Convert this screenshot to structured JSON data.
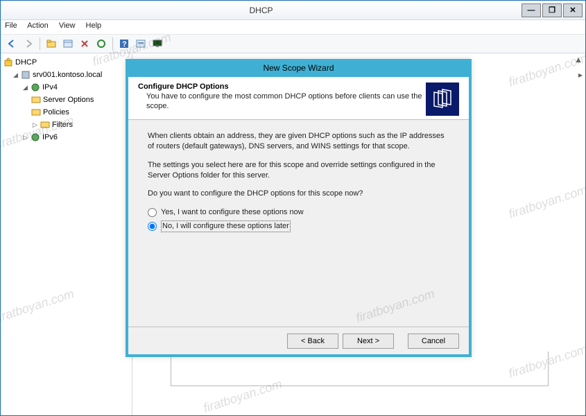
{
  "main": {
    "title": "DHCP",
    "menu": [
      "File",
      "Action",
      "View",
      "Help"
    ]
  },
  "window_controls": {
    "min": "—",
    "max": "❐",
    "close": "✕"
  },
  "tree": {
    "root": "DHCP",
    "server": "srv001.kontoso.local",
    "ipv4": "IPv4",
    "server_options": "Server Options",
    "policies": "Policies",
    "filters": "Filters",
    "ipv6": "IPv6"
  },
  "wizard": {
    "title": "New Scope Wizard",
    "heading": "Configure DHCP Options",
    "subtitle": "You have to configure the most common DHCP options before clients can use the scope.",
    "para1": "When clients obtain an address, they are given DHCP options such as the IP addresses of routers (default gateways), DNS servers, and WINS settings for that scope.",
    "para2": "The settings you select here are for this scope and override settings configured in the Server Options folder for this server.",
    "para3": "Do you want to configure the DHCP options for this scope now?",
    "option_yes": "Yes, I want to configure these options now",
    "option_no": "No, I will configure these options later",
    "back": "< Back",
    "next": "Next >",
    "cancel": "Cancel"
  },
  "watermark": "firatboyan.com"
}
